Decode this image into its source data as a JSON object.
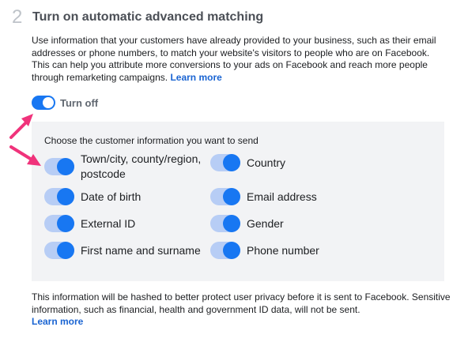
{
  "step": {
    "number": "2",
    "title": "Turn on automatic advanced matching"
  },
  "description": {
    "text": "Use information that your customers have already provided to your business, such as their email addresses or phone numbers, to match your website's visitors to people who are on Facebook. This can help you attribute more conversions to your ads on Facebook and reach more people through remarketing campaigns.",
    "learn_more": "Learn more"
  },
  "main_toggle": {
    "label": "Turn off",
    "state": "on"
  },
  "panel": {
    "title": "Choose the customer information you want to send",
    "options": [
      {
        "label": "Town/city, county/region, postcode",
        "state": "on"
      },
      {
        "label": "Country",
        "state": "on"
      },
      {
        "label": "Date of birth",
        "state": "on"
      },
      {
        "label": "Email address",
        "state": "on"
      },
      {
        "label": "External ID",
        "state": "on"
      },
      {
        "label": "Gender",
        "state": "on"
      },
      {
        "label": "First name and surname",
        "state": "on"
      },
      {
        "label": "Phone number",
        "state": "on"
      }
    ]
  },
  "footer": {
    "text": "This information will be hashed to better protect user privacy before it is sent to Facebook. Sensitive information, such as financial, health and government ID data, will not be sent.",
    "learn_more": "Learn more"
  },
  "colors": {
    "accent": "#1877f2",
    "link": "#1a64d2",
    "panel_bg": "#f2f3f5",
    "annotation_arrow": "#f0337b"
  }
}
